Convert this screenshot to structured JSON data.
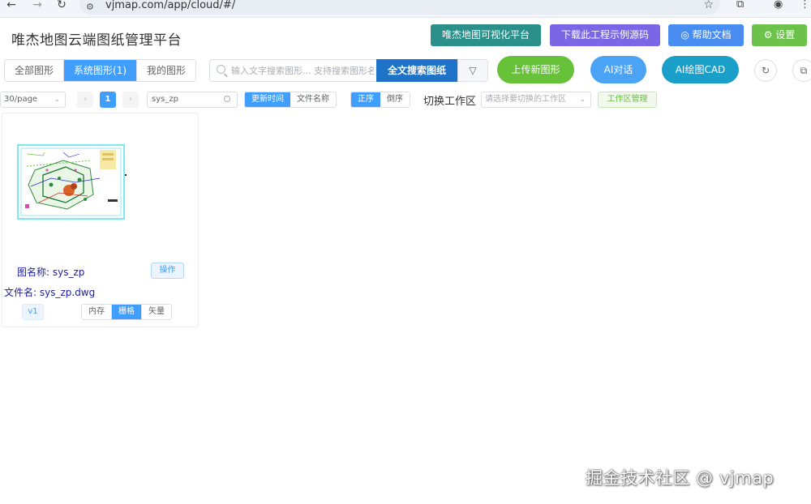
{
  "browser": {
    "url": "vjmap.com/app/cloud/#/",
    "back_icon": "arrow-left-icon",
    "forward_icon": "arrow-right-icon",
    "reload_icon": "reload-icon"
  },
  "header": {
    "title": "唯杰地图云端图纸管理平台",
    "buttons": {
      "visual_platform": "唯杰地图可视化平台",
      "download_source": "下载此工程示例源码",
      "help_docs": "帮助文档",
      "settings": "设置"
    },
    "colors": {
      "visual_platform": "#2b8f8a",
      "download_source": "#7b66e6",
      "help_docs": "#4a8df0",
      "settings": "#6cc24a"
    }
  },
  "toolbar": {
    "tabs": [
      "全部图形",
      "系统图形(1)",
      "我的图形"
    ],
    "active_tab": "系统图形(1)",
    "search_placeholder": "输入文字搜索图形... 支持搜索图形名称",
    "fulltext_button": "全文搜索图纸",
    "upload_button": "上传新图形",
    "ai_chat_button": "AI对话",
    "ai_cad_button": "AI绘图CAD",
    "colors": {
      "upload": "#67c23a",
      "ai_chat": "#4aa3f5",
      "ai_cad": "#1a9fc9"
    }
  },
  "filters": {
    "page_size": "30/page",
    "current_page": "1",
    "search_value": "sys_zp",
    "sort_field_options": [
      "更新时间",
      "文件名称"
    ],
    "sort_field_selected": "更新时间",
    "sort_order_options": [
      "正序",
      "倒序"
    ],
    "sort_order_selected": "正序",
    "workspace_label": "切换工作区",
    "workspace_placeholder": "请选择要切换的工作区",
    "workspace_manage_button": "工作区管理"
  },
  "cards": [
    {
      "name_label": "图名称: sys_zp",
      "operate_button": "操作",
      "file_label": "文件名: sys_zp.dwg",
      "version": "v1",
      "modes": [
        "内存",
        "栅格",
        "矢量"
      ],
      "selected_mode": "栅格"
    }
  ],
  "watermark": "掘金技术社区 @ vjmap"
}
